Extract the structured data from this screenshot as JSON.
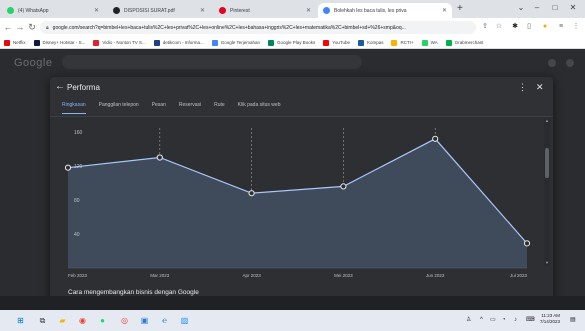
{
  "browser": {
    "tabs": [
      {
        "label": "(4) WhatsApp",
        "color": "#25d366"
      },
      {
        "label": "DISPOSISI SURAT.pdf",
        "color": "#202124"
      },
      {
        "label": "Pinterest",
        "color": "#e60023"
      },
      {
        "label": "Bolehkah les baca tulis, les priva",
        "color": "#4285f4"
      }
    ],
    "new_tab": "+",
    "address": "google.com/search?q=bimbel+les+baca+tulis%2C+les+privat%2C+les+online%2C+les+bahasa+inggris%2C+les+matematika%2C+bimbel+sd+%26+smp&oq...",
    "bookmarks": [
      {
        "label": "Netflix",
        "color": "#e50914"
      },
      {
        "label": "Disney+ Hotstar - S...",
        "color": "#0b1a4a"
      },
      {
        "label": "Vidio - Nonton TV S...",
        "color": "#e4202e"
      },
      {
        "label": "detikcom - Informa...",
        "color": "#1f3f86"
      },
      {
        "label": "Google Terjemahan",
        "color": "#4285f4"
      },
      {
        "label": "Google Play Books",
        "color": "#01875f"
      },
      {
        "label": "YouTube",
        "color": "#ff0000"
      },
      {
        "label": "Kompas",
        "color": "#1a5aa6"
      },
      {
        "label": "RCTI+",
        "color": "#f7b500"
      },
      {
        "label": "WA",
        "color": "#25d366"
      },
      {
        "label": "Grabmerchant",
        "color": "#00b14f"
      }
    ]
  },
  "page": {
    "logo": "Google"
  },
  "modal": {
    "title": "Performa",
    "tabs": [
      "Ringkasan",
      "Panggilan telepon",
      "Pesan",
      "Reservasi",
      "Rute",
      "Klik pada situs web"
    ],
    "active_tab": 0,
    "footer": "Cara mengembangkan bisnis dengan Google"
  },
  "chart_data": {
    "type": "area",
    "x": [
      "Feb 2023",
      "Mar 2023",
      "Apr 2023",
      "Mei 2023",
      "Jun 2023",
      "Jul 2023"
    ],
    "values": [
      118,
      130,
      88,
      96,
      152,
      29
    ],
    "ylim": [
      0,
      160
    ],
    "yticks": [
      40,
      80,
      120,
      160
    ],
    "grid": true,
    "line_color": "#a8c7fa",
    "fill_color": "#3f4a5b"
  },
  "taskbar": {
    "time": "11:23 AM",
    "date": "7/14/2023"
  }
}
